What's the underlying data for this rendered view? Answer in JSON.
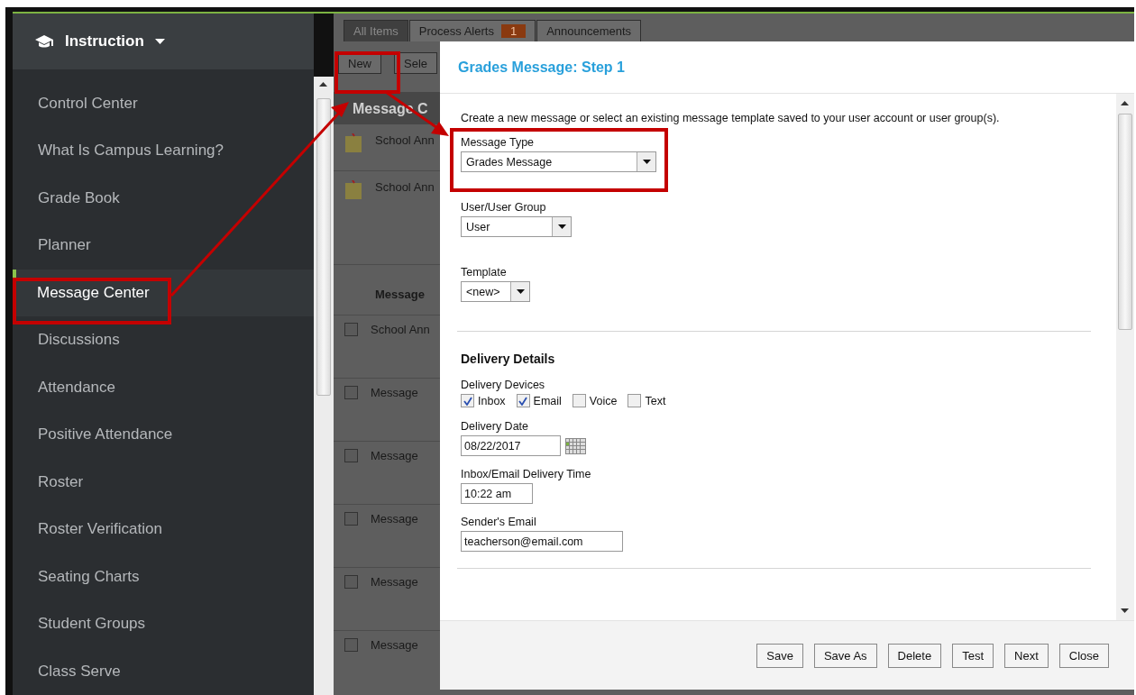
{
  "sidebar": {
    "title": "Instruction",
    "items": [
      {
        "label": "Control Center",
        "selected": false
      },
      {
        "label": "What Is Campus Learning?",
        "selected": false
      },
      {
        "label": "Grade Book",
        "selected": false
      },
      {
        "label": "Planner",
        "selected": false
      },
      {
        "label": "Message Center",
        "selected": true
      },
      {
        "label": "Discussions",
        "selected": false
      },
      {
        "label": "Attendance",
        "selected": false
      },
      {
        "label": "Positive Attendance",
        "selected": false
      },
      {
        "label": "Roster",
        "selected": false
      },
      {
        "label": "Roster Verification",
        "selected": false
      },
      {
        "label": "Seating Charts",
        "selected": false
      },
      {
        "label": "Student Groups",
        "selected": false
      },
      {
        "label": "Class Serve",
        "selected": false
      }
    ]
  },
  "background": {
    "tabs": [
      {
        "label": "All Items",
        "selected": true
      },
      {
        "label": "Process Alerts",
        "badge": "1",
        "selected": false
      },
      {
        "label": "Announcements",
        "selected": false
      }
    ],
    "toolbar": [
      "New",
      "Sele"
    ],
    "heading": "Message C",
    "rows": [
      {
        "kind": "note",
        "text": "School Ann"
      },
      {
        "kind": "note",
        "text": "School Ann"
      },
      {
        "kind": "header",
        "text": "Message"
      },
      {
        "kind": "check",
        "text": "School Ann",
        "checked": false
      },
      {
        "kind": "check",
        "text": "Message",
        "checked": false
      },
      {
        "kind": "check",
        "text": "Message",
        "checked": false
      },
      {
        "kind": "check",
        "text": "Message",
        "checked": false
      },
      {
        "kind": "check",
        "text": "Message",
        "checked": false
      },
      {
        "kind": "check",
        "text": "Message",
        "checked": false
      }
    ]
  },
  "dialog": {
    "title": "Grades Message: Step 1",
    "intro": "Create a new message or select an existing message template saved to your user account or user group(s).",
    "selects": [
      {
        "label": "Message Type",
        "value": "Grades Message"
      },
      {
        "label": "User/User Group",
        "value": "User"
      },
      {
        "label": "Template",
        "value": "<new>"
      }
    ],
    "section": "Delivery Details",
    "devices_label": "Delivery Devices",
    "devices": [
      {
        "label": "Inbox",
        "checked": true
      },
      {
        "label": "Email",
        "checked": true
      },
      {
        "label": "Voice",
        "checked": false
      },
      {
        "label": "Text",
        "checked": false
      }
    ],
    "inputs": [
      {
        "kind": "date",
        "label": "Delivery Date",
        "value": "08/22/2017"
      },
      {
        "kind": "time",
        "label": "Inbox/Email Delivery Time",
        "value": "10:22 am"
      },
      {
        "kind": "email",
        "label": "Sender's Email",
        "value": "teacherson@email.com"
      }
    ],
    "buttons": [
      "Save",
      "Save As",
      "Delete",
      "Test",
      "Next",
      "Close"
    ]
  }
}
